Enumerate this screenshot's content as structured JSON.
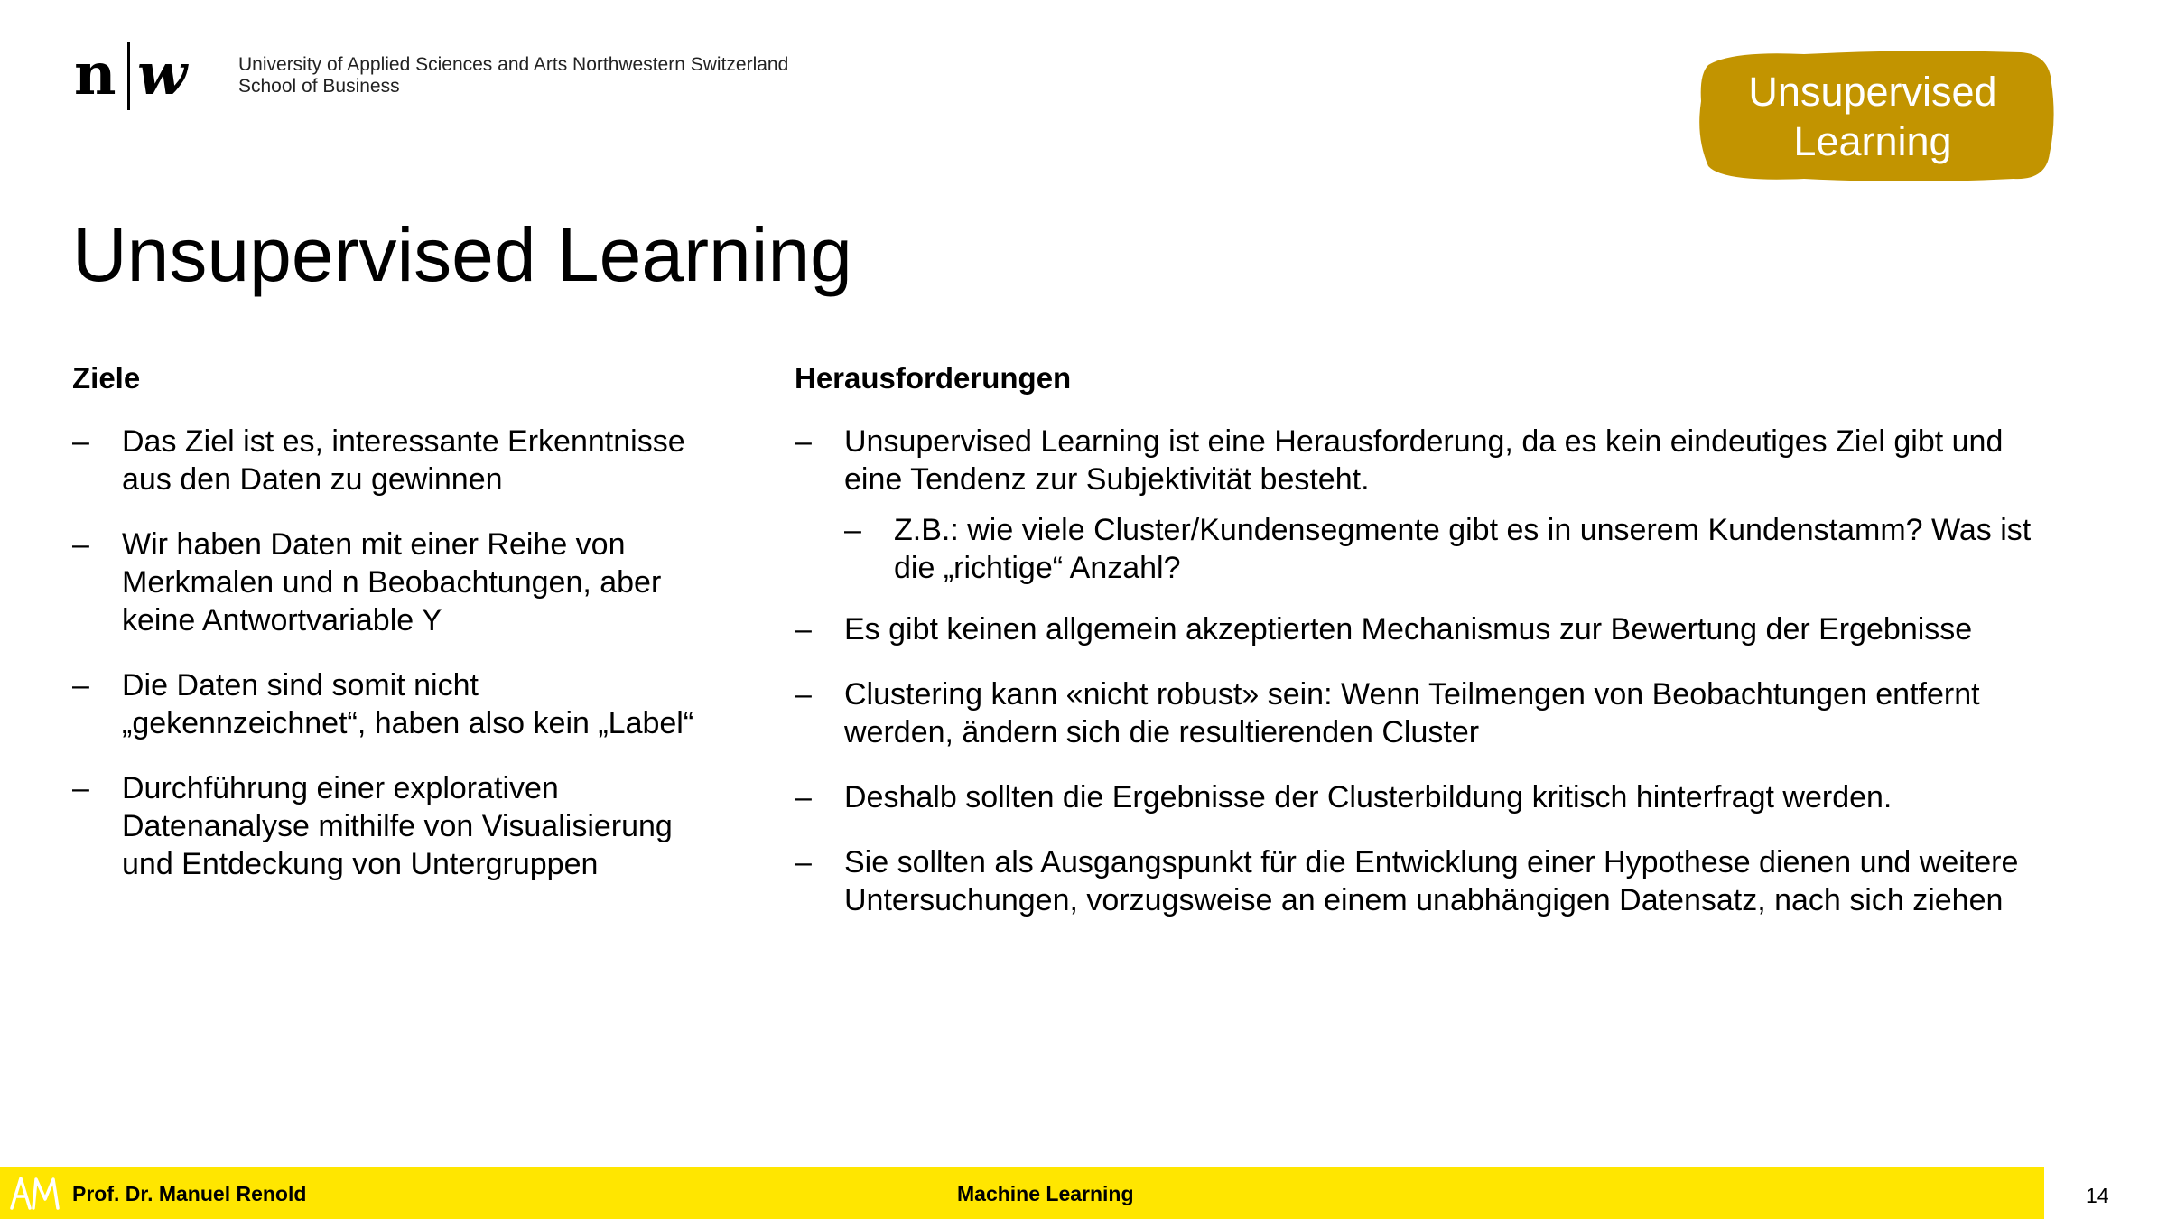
{
  "header": {
    "logo_text": "n|w",
    "university_line1": "University of Applied Sciences and Arts Northwestern Switzerland",
    "university_line2": "School of Business",
    "badge_line1": "Unsupervised",
    "badge_line2": "Learning"
  },
  "colors": {
    "badge": "#c29400",
    "footer": "#ffe600"
  },
  "title": "Unsupervised Learning",
  "left_column": {
    "heading": "Ziele",
    "bullets": [
      {
        "marker": "–",
        "text": "Das Ziel ist es, interessante Erkenntnisse aus den Daten zu gewinnen"
      },
      {
        "marker": "–",
        "text": "Wir haben Daten mit einer Reihe von Merkmalen und n Beobachtungen, aber keine Antwortvariable Y"
      },
      {
        "marker": "–",
        "text": "Die Daten sind somit nicht „gekennzeichnet“, haben also kein „Label“"
      },
      {
        "marker": "–",
        "text": "Durchführung einer explorativen Datenanalyse mithilfe von Visualisierung und Entdeckung von Untergruppen"
      }
    ]
  },
  "right_column": {
    "heading": "Herausforderungen",
    "bullets": [
      {
        "marker": "–",
        "text": "Unsupervised Learning ist eine Herausforderung, da es kein eindeutiges Ziel gibt und eine Tendenz zur Subjektivität besteht.",
        "sub": {
          "marker": "–",
          "text": "Z.B.: wie viele Cluster/Kundensegmente gibt es in unserem Kundenstamm? Was ist die „richtige“ Anzahl?"
        }
      },
      {
        "marker": "–",
        "text": "Es gibt keinen allgemein akzeptierten Mechanismus zur Bewertung der Ergebnisse"
      },
      {
        "marker": "–",
        "text": "Clustering kann «nicht robust» sein: Wenn Teilmengen von Beobachtungen entfernt werden, ändern sich die resultierenden Cluster"
      },
      {
        "marker": "–",
        "text": "Deshalb sollten die Ergebnisse der Clusterbildung kritisch hinterfragt werden."
      },
      {
        "marker": "–",
        "text": "Sie sollten als Ausgangspunkt für die Entwicklung einer Hypothese dienen und weitere Untersuchungen, vorzugsweise an einem unabhängigen Datensatz, nach sich ziehen"
      }
    ]
  },
  "footer": {
    "logo_text": "AM",
    "presenter": "Prof. Dr. Manuel Renold",
    "course": "Machine Learning",
    "page_number": "14"
  }
}
